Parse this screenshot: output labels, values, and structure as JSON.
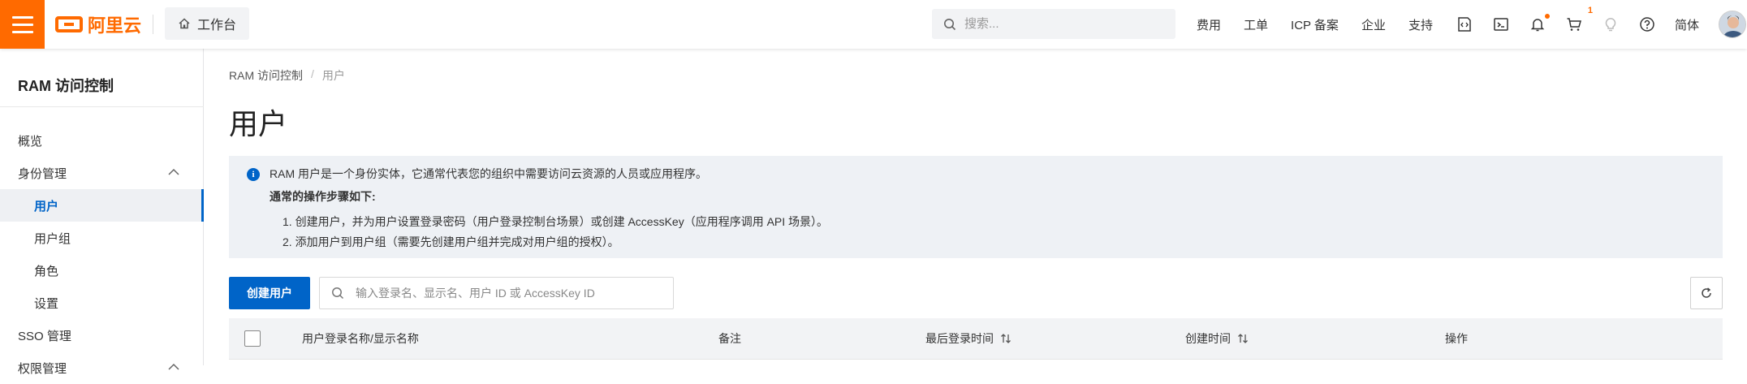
{
  "topbar": {
    "brand": "阿里云",
    "workbench_label": "工作台",
    "search_placeholder": "搜索...",
    "links": [
      "费用",
      "工单",
      "ICP 备案",
      "企业",
      "支持"
    ],
    "cart_count": "1",
    "language": "简体",
    "accent_color": "#ff6a00"
  },
  "sidebar": {
    "title": "RAM 访问控制",
    "items": [
      {
        "label": "概览"
      },
      {
        "label": "身份管理"
      },
      {
        "label": "用户"
      },
      {
        "label": "用户组"
      },
      {
        "label": "角色"
      },
      {
        "label": "设置"
      },
      {
        "label": "SSO 管理"
      },
      {
        "label": "权限管理"
      }
    ],
    "active_color": "#0064c8"
  },
  "main": {
    "breadcrumb": {
      "root": "RAM 访问控制",
      "separator": "/",
      "current": "用户"
    },
    "title": "用户",
    "info": {
      "line1": "RAM 用户是一个身份实体，它通常代表您的组织中需要访问云资源的人员或应用程序。",
      "heading": "通常的操作步骤如下:",
      "step1": "1. 创建用户，并为用户设置登录密码（用户登录控制台场景）或创建 AccessKey（应用程序调用 API 场景）。",
      "step2": "2. 添加用户到用户组（需要先创建用户组并完成对用户组的授权）。"
    },
    "create_button": "创建用户",
    "filter_placeholder": "输入登录名、显示名、用户 ID 或 AccessKey ID",
    "table": {
      "columns": [
        "用户登录名称/显示名称",
        "备注",
        "最后登录时间",
        "创建时间",
        "操作"
      ]
    }
  }
}
